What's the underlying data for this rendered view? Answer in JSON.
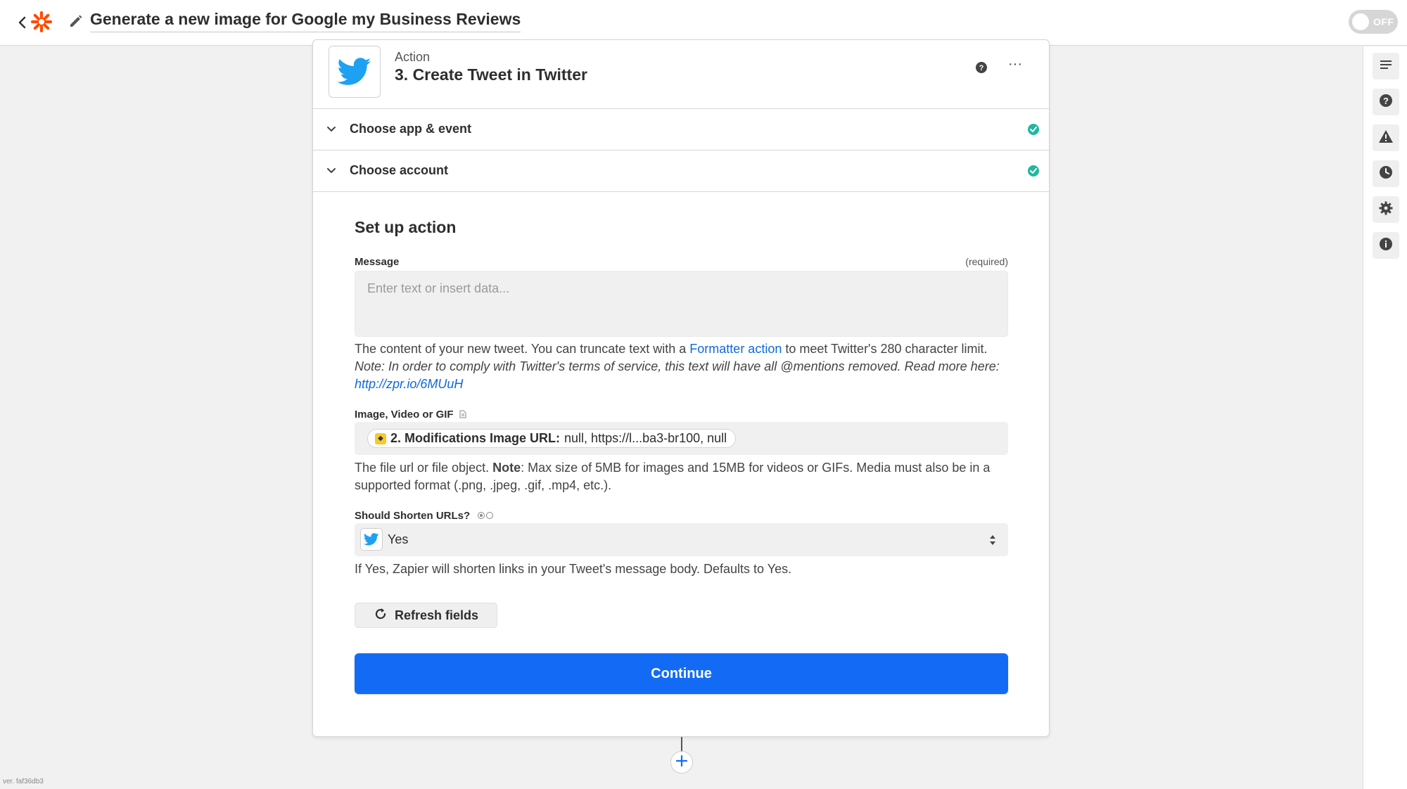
{
  "header": {
    "zap_title": "Generate a new image for Google my Business Reviews",
    "toggle_label": "OFF"
  },
  "step": {
    "kind": "Action",
    "title": "3. Create Tweet in Twitter"
  },
  "sections": [
    {
      "label": "Choose app & event"
    },
    {
      "label": "Choose account"
    }
  ],
  "setup": {
    "title": "Set up action",
    "message": {
      "label": "Message",
      "required": "(required)",
      "placeholder": "Enter text or insert data...",
      "help_before_link": "The content of your new tweet. You can truncate text with a ",
      "help_link": "Formatter action",
      "help_after_link": " to meet Twitter's 280 character limit.",
      "note": "Note: In order to comply with Twitter's terms of service, this text will have all @mentions removed. Read more here:",
      "note_link": "http://zpr.io/6MUuH"
    },
    "image": {
      "label": "Image, Video or GIF",
      "pill_bold": "2. Modifications Image URL:",
      "pill_value": "null, https://l...ba3-br100, null",
      "help_before": "The file url or file object. ",
      "help_bold": "Note",
      "help_after": ": Max size of 5MB for images and 15MB for videos or GIFs. Media must also be in a supported format (.png, .jpeg, .gif, .mp4, etc.)."
    },
    "shorten": {
      "label": "Should Shorten URLs?",
      "value": "Yes",
      "help": "If Yes, Zapier will shorten links in your Tweet's message body. Defaults to Yes."
    },
    "refresh_label": "Refresh fields",
    "continue_label": "Continue"
  },
  "footer": {
    "version": "ver. faf36db3"
  },
  "colors": {
    "accent": "#136bf5",
    "link": "#0f68e0",
    "success": "#1fb8a0",
    "zapier_orange": "#ff4a00",
    "twitter_blue": "#1da1f2"
  },
  "icons": {
    "sidebar": [
      "list-icon",
      "help-icon",
      "warning-icon",
      "history-icon",
      "settings-icon",
      "info-icon"
    ]
  }
}
